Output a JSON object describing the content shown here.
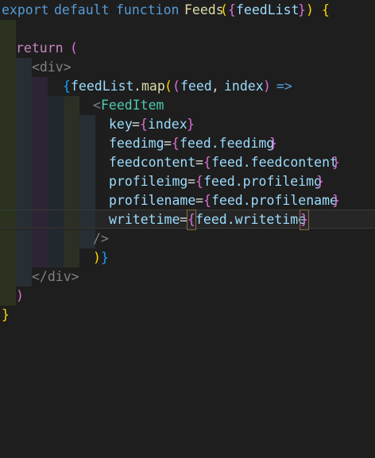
{
  "code": {
    "l1": {
      "kw1": "export",
      "kw2": "default",
      "kw3": "function",
      "fn": "Feeds",
      "open": "(",
      "brace_open": "{",
      "param": "feedList",
      "brace_close": "}",
      "close": ")",
      "body_open": "{"
    },
    "l3": {
      "kw": "return",
      "paren": "("
    },
    "l4": {
      "tag": "<div>"
    },
    "l5": {
      "brace": "{",
      "obj": "feedList",
      "dot": ".",
      "method": "map",
      "p1": "(",
      "p2": "(",
      "arg1": "feed",
      "comma": ", ",
      "arg2": "index",
      "p3": ")",
      "arrow": " =>"
    },
    "l6": {
      "lt": "<",
      "tag": "FeedItem"
    },
    "l7": {
      "attr": "key",
      "eq": "=",
      "b1": "{",
      "val": "index",
      "b2": "}"
    },
    "l8": {
      "attr": "feedimg",
      "eq": "=",
      "b1": "{",
      "val": "feed.feedimg",
      "b2": "}"
    },
    "l9": {
      "attr": "feedcontent",
      "eq": "=",
      "b1": "{",
      "val": "feed.feedcontent",
      "b2": "}"
    },
    "l10": {
      "attr": "profileimg",
      "eq": "=",
      "b1": "{",
      "val": "feed.profileimg",
      "b2": "}"
    },
    "l11": {
      "attr": "profilename",
      "eq": "=",
      "b1": "{",
      "val": "feed.profilename",
      "b2": "}"
    },
    "l12": {
      "attr": "writetime",
      "eq": "=",
      "b1": "{",
      "val": "feed.writetime",
      "b2": "}"
    },
    "l13": {
      "text": "/>"
    },
    "l14": {
      "p": ")",
      "b": "}"
    },
    "l15": {
      "text": "</div>"
    },
    "l16": {
      "text": ")"
    },
    "l17": {
      "text": "}"
    }
  },
  "colors": {
    "background": "#1e1e1e",
    "keyword": "#569cd6",
    "control_keyword": "#c586c0",
    "function": "#dcdcaa",
    "variable": "#9cdcfe",
    "component": "#4ec9b0",
    "bracket_gold": "#ffd700",
    "bracket_orchid": "#da70d6",
    "bracket_blue": "#179fff"
  }
}
